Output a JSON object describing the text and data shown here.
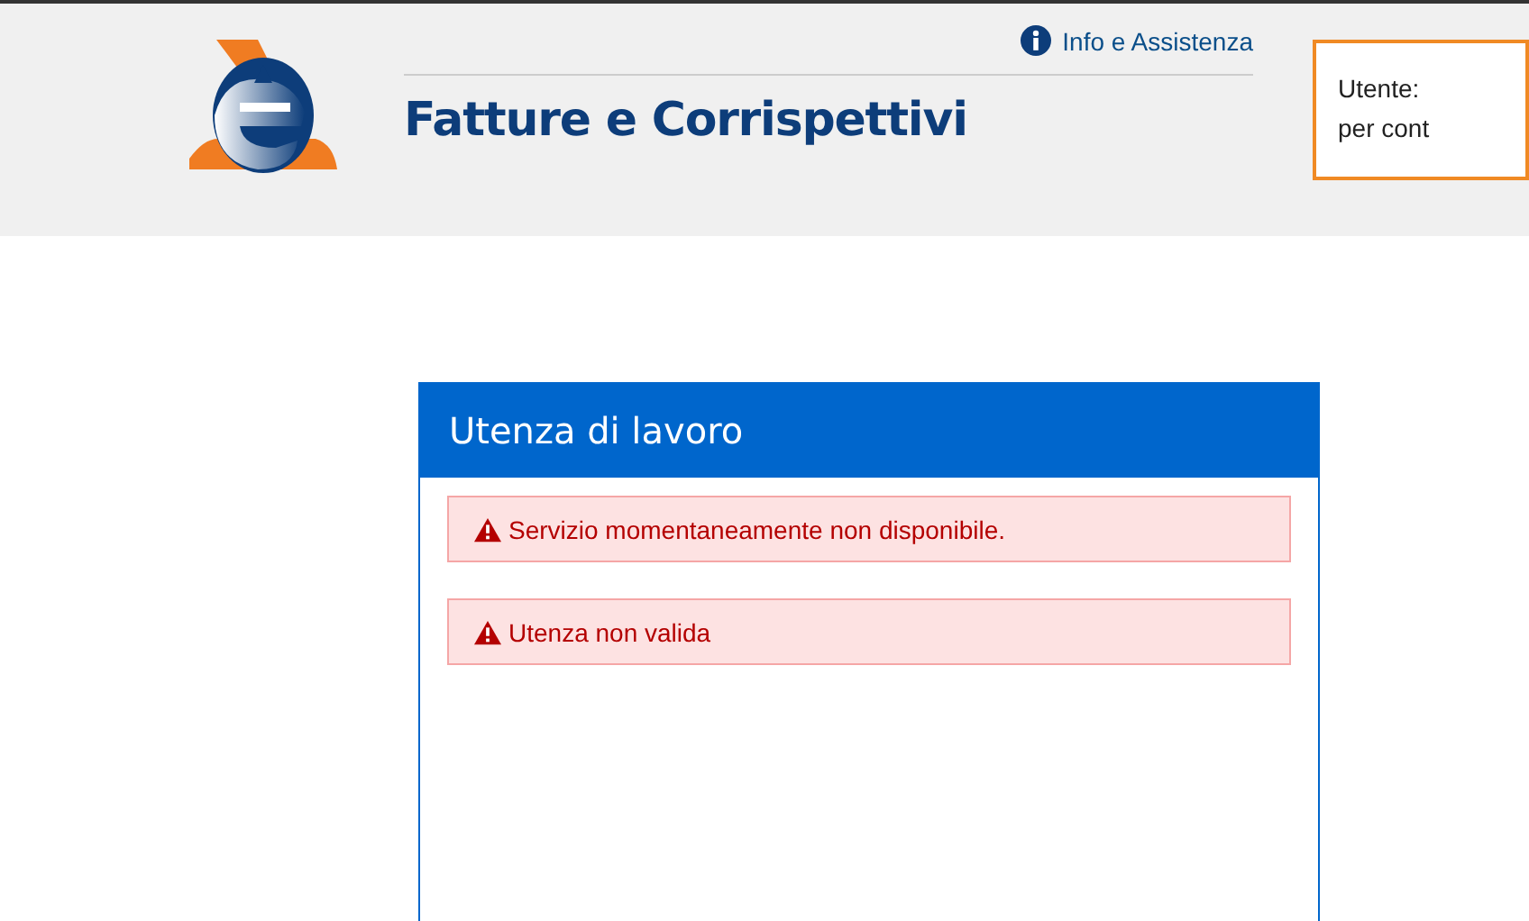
{
  "header": {
    "title": "Fatture e Corrispettivi",
    "help_link": "Info e Assistenza",
    "user_box": {
      "line_1": "Utente:",
      "line_2": "per cont"
    }
  },
  "panel": {
    "title": "Utenza di lavoro",
    "alerts": [
      {
        "kind": "error",
        "text": "Servizio momentaneamente non disponibile."
      },
      {
        "kind": "error",
        "text": "Utenza non valida"
      }
    ]
  }
}
